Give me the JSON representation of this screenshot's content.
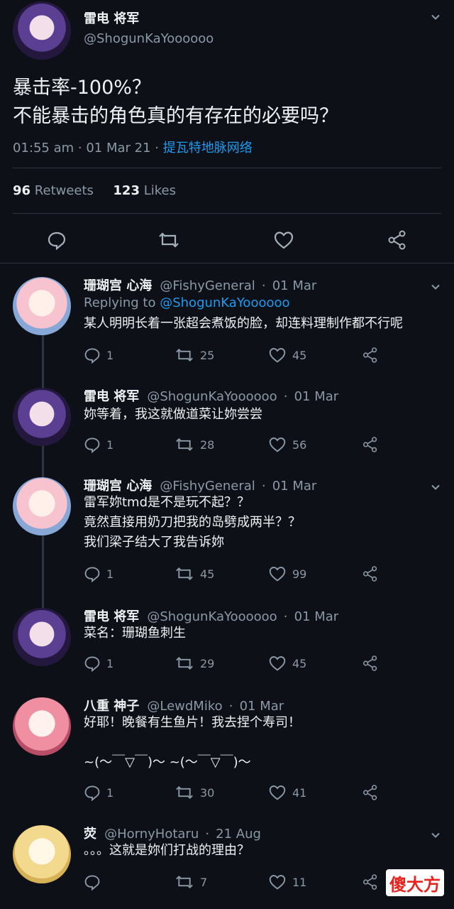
{
  "main_tweet": {
    "name": "雷电 将军",
    "handle": "@ShogunKaYoooooo",
    "text_line1": "暴击率-100%？",
    "text_line2": "不能暴击的角色真的有存在的必要吗？",
    "time": "01:55 am · 01 Mar 21 ·",
    "source": "提瓦特地脉网络",
    "retweets": "96",
    "retweets_label": "Retweets",
    "likes": "123",
    "likes_label": "Likes"
  },
  "replies": [
    {
      "name": "珊瑚宫 心海",
      "handle": "@FishyGeneral",
      "time": "01 Mar",
      "replying_label": "Replying to",
      "replying_to": "@ShogunKaYoooooo",
      "text": "某人明明长着一张超会煮饭的脸，却连料理制作都不行呢",
      "counts": {
        "reply": "1",
        "retweet": "25",
        "like": "45"
      }
    },
    {
      "name": "雷电 将军",
      "handle": "@ShogunKaYoooooo",
      "time": "01 Mar",
      "text": "妳等着，我这就做道菜让妳尝尝",
      "counts": {
        "reply": "1",
        "retweet": "28",
        "like": "56"
      }
    },
    {
      "name": "珊瑚宫 心海",
      "handle": "@FishyGeneral",
      "time": "01 Mar",
      "text": "雷军妳tmd是不是玩不起？？\n竟然直接用奶刀把我的岛劈成两半？？\n我们梁子结大了我告诉妳",
      "counts": {
        "reply": "1",
        "retweet": "45",
        "like": "99"
      }
    },
    {
      "name": "雷电 将军",
      "handle": "@ShogunKaYoooooo",
      "time": "01 Mar",
      "text": "菜名：珊瑚鱼刺生",
      "counts": {
        "reply": "1",
        "retweet": "29",
        "like": "45"
      }
    },
    {
      "name": "八重 神子",
      "handle": "@LewdMiko",
      "time": "01 Mar",
      "text": "好耶！晚餐有生鱼片！我去捏个寿司！\n\n~(～￣▽￣)～ ~(～￣▽￣)～",
      "counts": {
        "reply": "1",
        "retweet": "30",
        "like": "41"
      }
    },
    {
      "name": "荧",
      "handle": "@HornyHotaru",
      "time": "21 Aug",
      "text": "。。。这就是妳们打战的理由？",
      "counts": {
        "reply": "",
        "retweet": "7",
        "like": "11"
      }
    }
  ],
  "watermark": "傻大方",
  "icons": {
    "reply": "reply-icon",
    "retweet": "retweet-icon",
    "like": "heart-icon",
    "share": "share-icon",
    "chevron": "chevron-down-icon"
  },
  "colors": {
    "background": "#0d1117",
    "link": "#1d9bf0",
    "muted": "#8b98a5",
    "text": "#eef2f5"
  }
}
